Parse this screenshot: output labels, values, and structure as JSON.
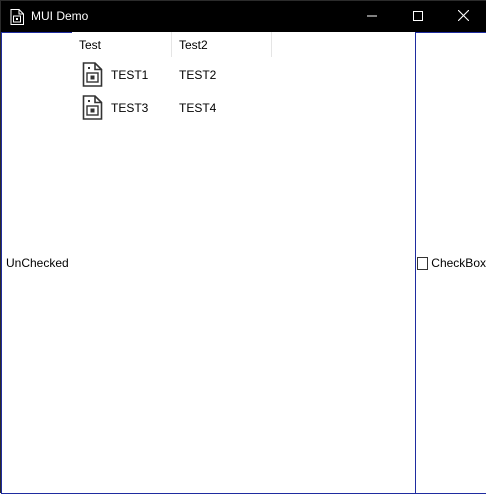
{
  "window": {
    "title": "MUI Demo",
    "controls": {
      "minimize_icon": "minimize-icon",
      "maximize_icon": "maximize-icon",
      "close_icon": "close-icon"
    }
  },
  "left_panel": {
    "label": "UnChecked"
  },
  "list": {
    "columns": [
      "Test",
      "Test2"
    ],
    "rows": [
      {
        "icon": "document-icon",
        "col1": "TEST1",
        "col2": "TEST2"
      },
      {
        "icon": "document-icon",
        "col1": "TEST3",
        "col2": "TEST4"
      }
    ]
  },
  "right_panel": {
    "checkbox_label": "CheckBox",
    "checked": false
  },
  "colors": {
    "titlebar": "#000000",
    "panel_border": "#1f2ca0"
  }
}
